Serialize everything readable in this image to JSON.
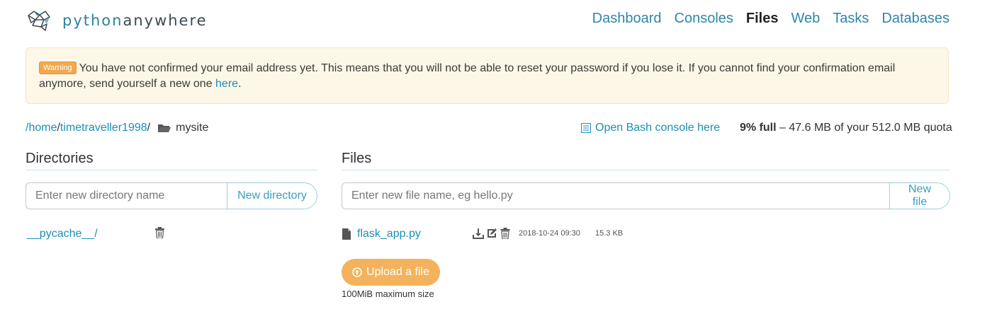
{
  "brand": {
    "part1": "python",
    "part2": "anywhere"
  },
  "nav": [
    {
      "label": "Dashboard",
      "active": false
    },
    {
      "label": "Consoles",
      "active": false
    },
    {
      "label": "Files",
      "active": true
    },
    {
      "label": "Web",
      "active": false
    },
    {
      "label": "Tasks",
      "active": false
    },
    {
      "label": "Databases",
      "active": false
    }
  ],
  "warning": {
    "badge": "Warning",
    "text": "You have not confirmed your email address yet. This means that you will not be able to reset your password if you lose it. If you cannot find your confirmation email anymore, send yourself a new one ",
    "link": "here",
    "end": "."
  },
  "breadcrumb": {
    "root": "/home",
    "user": "timetraveller1998",
    "sep": "/",
    "current": "mysite"
  },
  "bash_link": "Open Bash console here",
  "quota": {
    "percent": "9% full",
    "dash": " – ",
    "used": "47.6 MB",
    "of": " of your ",
    "total": "512.0 MB",
    "suffix": " quota"
  },
  "directories": {
    "title": "Directories",
    "placeholder": "Enter new directory name",
    "button": "New directory",
    "items": [
      {
        "name": "__pycache__/"
      }
    ]
  },
  "files": {
    "title": "Files",
    "placeholder": "Enter new file name, eg hello.py",
    "button": "New file",
    "items": [
      {
        "name": "flask_app.py",
        "modified": "2018-10-24 09:30",
        "size": "15.3 KB"
      }
    ]
  },
  "upload": {
    "button": "Upload a file",
    "note": "100MiB maximum size"
  },
  "colors": {
    "link": "#1a8fb5",
    "upload": "#f3b25c",
    "warning_bg": "#fcf7e6",
    "badge": "#f0a94f"
  }
}
